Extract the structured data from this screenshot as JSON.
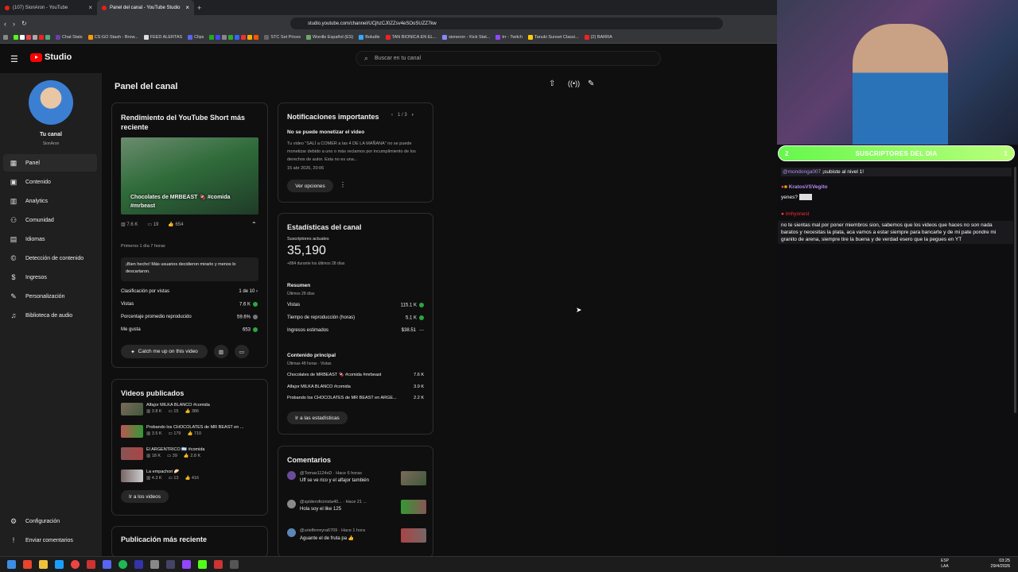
{
  "browser": {
    "tab1": "(107) SionAron - YouTube",
    "tab2": "Panel del canal - YouTube Studio",
    "url": "studio.youtube.com/channel/UCjhzCJ0ZZsv4eSOoSUZZ7kw",
    "bookmarks": [
      "Chat Stats",
      "CS:GO Stash - Brow...",
      "FEED ALERTAS",
      "Clips",
      "STC Set Prices",
      "Wordle Español (ES)",
      "Boludle",
      "TAN BIONICA EN EL...",
      "sioneron - Kick Stat...",
      "trr - Twitch",
      "Tanuki Sunset Classi...",
      "(2) BARRA"
    ]
  },
  "studio": {
    "logo": "Studio",
    "search_placeholder": "Buscar en tu canal",
    "page_title": "Panel del canal"
  },
  "sidebar": {
    "channel_label": "Tu canal",
    "channel_name": "SionAron",
    "items": [
      {
        "label": "Panel",
        "icon": "dashboard-icon"
      },
      {
        "label": "Contenido",
        "icon": "content-icon"
      },
      {
        "label": "Analytics",
        "icon": "analytics-icon"
      },
      {
        "label": "Comunidad",
        "icon": "community-icon"
      },
      {
        "label": "Idiomas",
        "icon": "subtitles-icon"
      },
      {
        "label": "Detección de contenido",
        "icon": "copyright-icon"
      },
      {
        "label": "Ingresos",
        "icon": "earn-icon"
      },
      {
        "label": "Personalización",
        "icon": "customize-icon"
      },
      {
        "label": "Biblioteca de audio",
        "icon": "audio-icon"
      }
    ],
    "settings": "Configuración",
    "feedback": "Enviar comentarios"
  },
  "short": {
    "title": "Rendimiento del YouTube Short más reciente",
    "video_title": "Chocolates de MRBEAST 🍫 #comida #mrbeast",
    "views": "7.6 K",
    "comments": "19",
    "likes": "654",
    "period": "Primeros 1 día 7 horas",
    "message": "¡Bien hecho! Más usuarios decidieron mirarlo y menos lo descartaron.",
    "stats": [
      {
        "label": "Clasificación por vistas",
        "value": "1 de 10 ›"
      },
      {
        "label": "Vistas",
        "value": "7.6 K"
      },
      {
        "label": "Porcentaje promedio reproducido",
        "value": "59.6%"
      },
      {
        "label": "Me gusta",
        "value": "653"
      }
    ],
    "catch_up": "Catch me up on this video"
  },
  "published": {
    "title": "Videos publicados",
    "items": [
      {
        "title": "Alfajor MILKA BLANCO #comida",
        "views": "3.8 K",
        "comments": "15",
        "likes": "386"
      },
      {
        "title": "Probando los CHOCOLATES de MR BEAST en ...",
        "views": "3.5 K",
        "comments": "179",
        "likes": "710"
      },
      {
        "title": "El ARGENTRICO 🇦🇷 #comida",
        "views": "18 K",
        "comments": "39",
        "likes": "2.8 K"
      },
      {
        "title": "La empachori 🥟",
        "views": "4.3 K",
        "comments": "13",
        "likes": "416"
      }
    ],
    "button": "Ir a los videos"
  },
  "latest_post": {
    "title": "Publicación más reciente"
  },
  "notifications": {
    "title": "Notificaciones importantes",
    "pager": "1 / 3",
    "heading": "No se puede monetizar el video",
    "body": "Tu video \"SALÍ a COMER a las 4 DE LA MAÑANA\" no se puede monetizar debido a uno o más reclamos por incumplimiento de los derechos de autor. Esta no es una...",
    "date": "15 abr 2026, 20:06",
    "button": "Ver opciones"
  },
  "channel_stats": {
    "title": "Estadísticas del canal",
    "subs_label": "Suscriptores actuales",
    "subs": "35,190",
    "subs_delta": "+884 durante los últimos 28 días",
    "summary": "Resumen",
    "summary_period": "Últimos 28 días",
    "rows": [
      {
        "label": "Vistas",
        "value": "115.1 K",
        "status": "up"
      },
      {
        "label": "Tiempo de reproducción (horas)",
        "value": "5.1 K",
        "status": "up"
      },
      {
        "label": "Ingresos estimados",
        "value": "$38.51",
        "status": "flat"
      }
    ],
    "top_title": "Contenido principal",
    "top_period": "Últimas 48 horas · Vistas",
    "top": [
      {
        "title": "Chocolates de MRBEAST 🍫 #comida #mrbeast",
        "value": "7.6 K"
      },
      {
        "title": "Alfajor MILKA BLANCO #comida",
        "value": "3.9 K"
      },
      {
        "title": "Probando los CHOCOLATES de MR BEAST en ARGE...",
        "value": "2.2 K"
      }
    ],
    "button": "Ir a las estadísticas"
  },
  "comments": {
    "title": "Comentarios",
    "items": [
      {
        "user": "@Tomas1124xD",
        "time": "· Hace 6 horas",
        "text": "Uff se ve rico y el alfajor también"
      },
      {
        "user": "@spideroficinista40...",
        "time": "· Hace 21 ...",
        "text": "Hola soy el like 125"
      },
      {
        "user": "@urielferreyra6709",
        "time": "· Hace 1 hora",
        "text": "Aguante el de fruta pa 👍"
      }
    ]
  },
  "stream": {
    "bar_left": "2",
    "bar_text": "SUSCRIPTORES DEL DIA",
    "bar_right": "1",
    "msg1_user": "@mondonga007",
    "msg1_text": "¡subiste al nivel 1!",
    "msg2_user": "KratosVSVegito",
    "msg2_text": "yenes?",
    "msg3_user": "imhyonest",
    "msg3_text": "no te sientas mal por poner miembros sion, sabemos que los videos que haces no son nada baratos y necesitas la plata, aca vamos a estar siempre para bancarte y de mi pate pondre mi granito de arena, siempre tire la buena y de verdad esero que la pegues en YT"
  },
  "taskbar": {
    "lang": "ESP",
    "lang2": "LAA",
    "time": "03:25",
    "date": "29/4/2026"
  }
}
